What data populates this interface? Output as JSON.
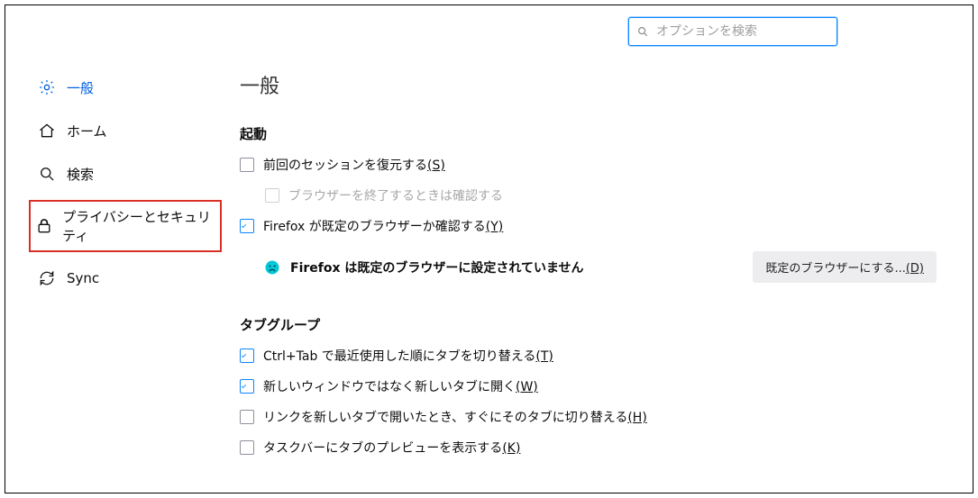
{
  "search": {
    "placeholder": "オプションを検索"
  },
  "sidebar": {
    "items": [
      {
        "label": "一般"
      },
      {
        "label": "ホーム"
      },
      {
        "label": "検索"
      },
      {
        "label": "プライバシーとセキュリティ"
      },
      {
        "label": "Sync"
      }
    ]
  },
  "main": {
    "title": "一般",
    "startup": {
      "heading": "起動",
      "restore_label": "前回のセッションを復元する",
      "restore_key": "(S)",
      "confirm_on_quit_label": "ブラウザーを終了するときは確認する",
      "check_default_label": "Firefox が既定のブラウザーか確認する",
      "check_default_key": "(Y)",
      "not_default_msg": "Firefox は既定のブラウザーに設定されていません",
      "make_default_btn_label": "既定のブラウザーにする...",
      "make_default_btn_key": "(D)"
    },
    "tabs": {
      "heading": "タブグループ",
      "ctrl_tab_label": "Ctrl+Tab で最近使用した順にタブを切り替える",
      "ctrl_tab_key": "(T)",
      "new_tab_label": "新しいウィンドウではなく新しいタブに開く",
      "new_tab_key": "(W)",
      "switch_immediately_label": "リンクを新しいタブで開いたとき、すぐにそのタブに切り替える",
      "switch_immediately_key": "(H)",
      "taskbar_preview_label": "タスクバーにタブのプレビューを表示する",
      "taskbar_preview_key": "(K)"
    }
  }
}
